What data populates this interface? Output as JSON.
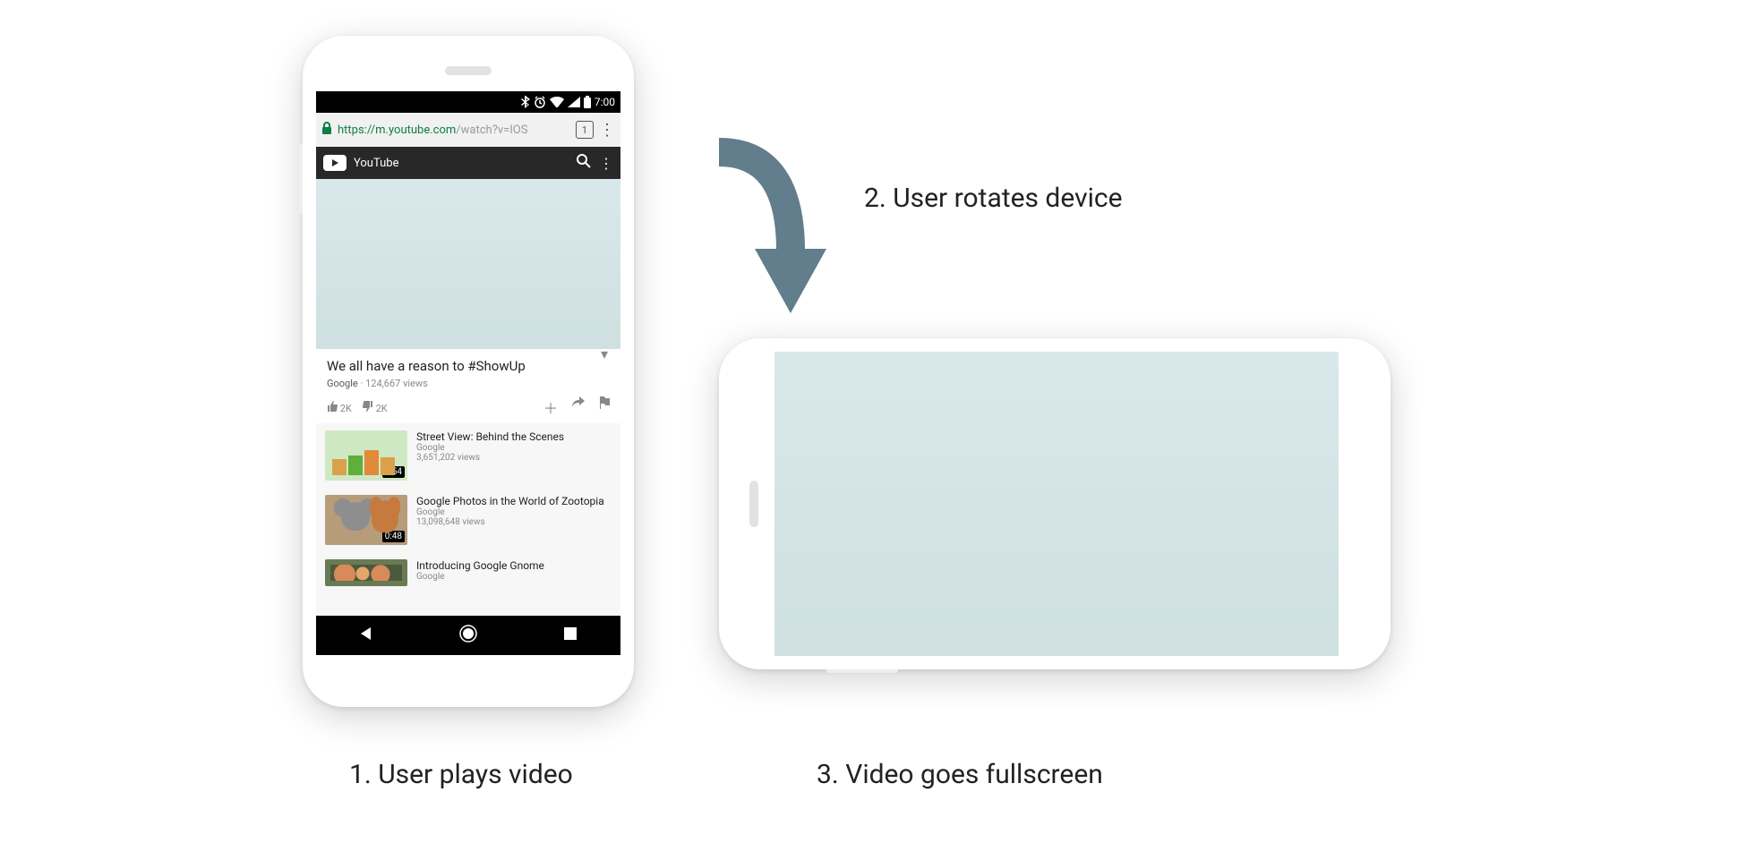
{
  "captions": {
    "step1": "1. User plays video",
    "step2": "2. User rotates device",
    "step3": "3. Video goes fullscreen"
  },
  "statusbar": {
    "time": "7:00"
  },
  "browser": {
    "url_scheme": "https://",
    "url_host": "m.youtube.com",
    "url_path": "/watch?v=IOS",
    "tab_count": "1"
  },
  "youtube": {
    "brand": "YouTube"
  },
  "video": {
    "title": "We all have a reason to #ShowUp",
    "channel": "Google",
    "views": "124,667 views",
    "likes": "2K",
    "dislikes": "2K"
  },
  "related": [
    {
      "title": "Street View: Behind the Scenes",
      "channel": "Google",
      "views": "3,651,202 views",
      "duration": "1:54",
      "thumb": "a"
    },
    {
      "title": "Google Photos in the World of Zootopia",
      "channel": "Google",
      "views": "13,098,648 views",
      "duration": "0:48",
      "thumb": "b"
    },
    {
      "title": "Introducing Google Gnome",
      "channel": "Google",
      "views": "",
      "duration": "",
      "thumb": "c"
    }
  ]
}
